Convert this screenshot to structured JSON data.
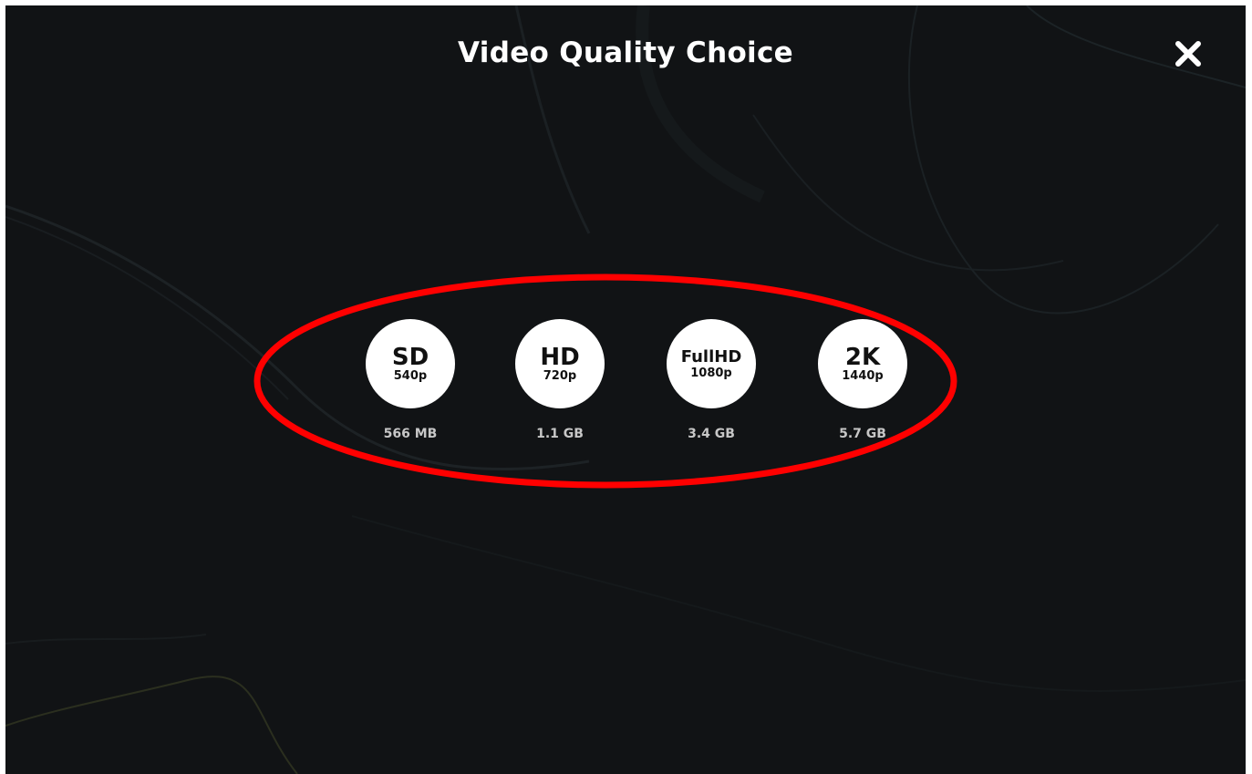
{
  "dialog": {
    "title": "Video Quality Choice",
    "close_icon": "close-icon"
  },
  "options": [
    {
      "name": "SD",
      "resolution": "540p",
      "size": "566 MB"
    },
    {
      "name": "HD",
      "resolution": "720p",
      "size": "1.1 GB"
    },
    {
      "name": "FullHD",
      "resolution": "1080p",
      "size": "3.4 GB"
    },
    {
      "name": "2K",
      "resolution": "1440p",
      "size": "5.7 GB"
    }
  ],
  "colors": {
    "background": "#111315",
    "highlight": "#ff0000",
    "option_fill": "#ffffff",
    "size_text": "#c7c7c7"
  }
}
